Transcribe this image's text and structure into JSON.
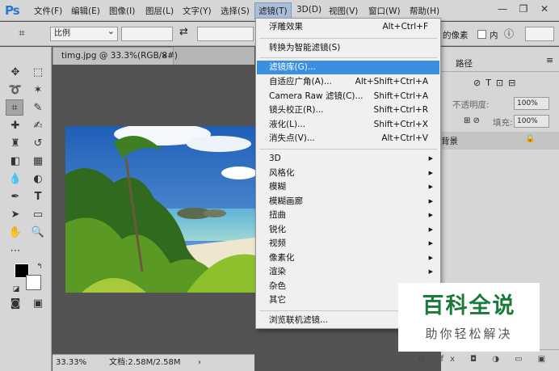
{
  "app": {
    "logo": "Ps"
  },
  "menubar": {
    "items": [
      {
        "label": "文件(F)"
      },
      {
        "label": "编辑(E)"
      },
      {
        "label": "图像(I)"
      },
      {
        "label": "图层(L)"
      },
      {
        "label": "文字(Y)"
      },
      {
        "label": "选择(S)"
      },
      {
        "label": "滤镜(T)"
      },
      {
        "label": "3D(D)"
      },
      {
        "label": "视图(V)"
      },
      {
        "label": "窗口(W)"
      },
      {
        "label": "帮助(H)"
      }
    ],
    "active_label": "滤镜(T)"
  },
  "optionsbar": {
    "ratio_value": "比例",
    "partial_text": "的像素",
    "check_label": "内",
    "swap_icon": "swap-icon"
  },
  "document": {
    "tab_title": "timg.jpg @ 33.3%(RGB/8#)",
    "zoom": "33.33%",
    "doc_info": "文档:2.58M/2.58M"
  },
  "filter_menu": {
    "last_filter": {
      "label": "浮雕效果",
      "shortcut": "Alt+Ctrl+F"
    },
    "convert": {
      "label": "转换为智能滤镜(S)"
    },
    "group1": [
      {
        "label": "滤镜库(G)...",
        "shortcut": ""
      },
      {
        "label": "自适应广角(A)...",
        "shortcut": "Alt+Shift+Ctrl+A"
      },
      {
        "label": "Camera Raw 滤镜(C)...",
        "shortcut": "Shift+Ctrl+A"
      },
      {
        "label": "镜头校正(R)...",
        "shortcut": "Shift+Ctrl+R"
      },
      {
        "label": "液化(L)...",
        "shortcut": "Shift+Ctrl+X"
      },
      {
        "label": "消失点(V)...",
        "shortcut": "Alt+Ctrl+V"
      }
    ],
    "submenus": [
      {
        "label": "3D"
      },
      {
        "label": "风格化"
      },
      {
        "label": "模糊"
      },
      {
        "label": "模糊画廊"
      },
      {
        "label": "扭曲"
      },
      {
        "label": "锐化"
      },
      {
        "label": "视频"
      },
      {
        "label": "像素化"
      },
      {
        "label": "渲染"
      },
      {
        "label": "杂色"
      },
      {
        "label": "其它"
      }
    ],
    "browse": {
      "label": "浏览联机滤镜..."
    }
  },
  "right_panel": {
    "tab_paths": "路径",
    "opacity_label": "不透明度:",
    "opacity_value": "100%",
    "fill_label": "填充:",
    "fill_value": "100%",
    "layer_name": "背景"
  },
  "watermark": {
    "title": "百科全说",
    "subtitle": "助你轻松解决"
  },
  "colors": {
    "accent": "#3b8fe0",
    "menu_bg": "#f0f0f0",
    "ui_bg": "#d6d6d6",
    "workspace": "#535353"
  }
}
